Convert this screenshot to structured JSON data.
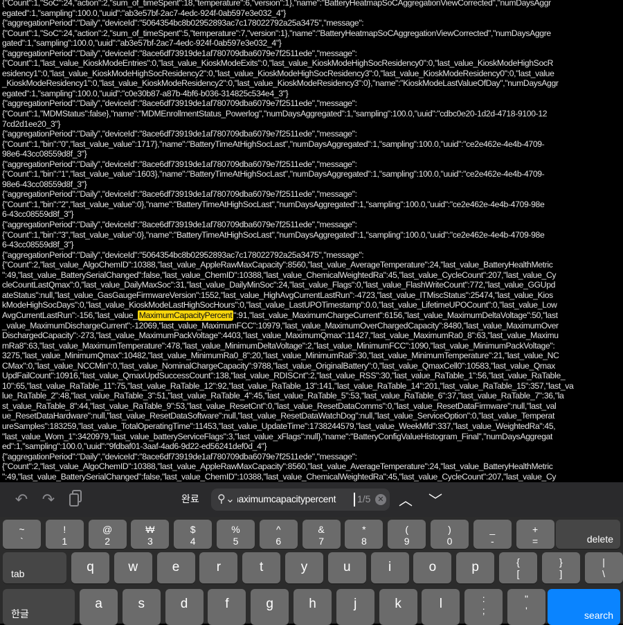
{
  "log": {
    "lines": [
      "{\"Count\":1,\"SoC\":24,\"action\":2,\"sum_of_timeSpent\":18,\"temperature\":6,\"version\":1},\"name\":\"BatteryHeatmapSoCAggregationViewCorrected\",\"numDaysAggr",
      "egated\":1,\"sampling\":100.0,\"uuid\":\"ab3e57bf-2ac7-4edc-924f-0ab597e3e032_4\"}",
      "{\"aggregationPeriod\":\"Daily\",\"deviceId\":\"5064354bc8b02952893ac7c178022792a25a3475\",\"message\":",
      "{\"Count\":1,\"SoC\":24,\"action\":2,\"sum_of_timeSpent\":5,\"temperature\":7,\"version\":1},\"name\":\"BatteryHeatmapSoCAggregationViewCorrected\",\"numDaysAggre",
      "gated\":1,\"sampling\":100.0,\"uuid\":\"ab3e57bf-2ac7-4edc-924f-0ab597e3e032_4\"}",
      "{\"aggregationPeriod\":\"Daily\",\"deviceId\":\"8ace6df73919de1af780709dba6079e7f2511ede\",\"message\":",
      "{\"Count\":1,\"last_value_KioskModeEntries\":0,\"last_value_KioskModeExits\":0,\"last_value_KioskModeHighSocResidency0\":0,\"last_value_KioskModeHighSocR",
      "esidency1\":0,\"last_value_KioskModeHighSocResidency2\":0,\"last_value_KioskModeHighSocResidency3\":0,\"last_value_KioskModeResidency0\":0,\"last_value",
      "_KioskModeResidency1\":0,\"last_value_KioskModeResidency2\":0,\"last_value_KioskModeResidency3\":0},\"name\":\"KioskModeLastValueOfDay\",\"numDaysAggr",
      "egated\":1,\"sampling\":100.0,\"uuid\":\"c0e30b87-a87b-4bf6-b036-314825c534e4_3\"}",
      "{\"aggregationPeriod\":\"Daily\",\"deviceId\":\"8ace6df73919de1af780709dba6079e7f2511ede\",\"message\":",
      "{\"Count\":1,\"MDMStatus\":false},\"name\":\"MDMEnrollmentStatus_Powerlog\",\"numDaysAggregated\":1,\"sampling\":100.0,\"uuid\":\"cdbc0e20-1d2d-4718-9100-12",
      "7cd2d1ee20_3\"}",
      "{\"aggregationPeriod\":\"Daily\",\"deviceId\":\"8ace6df73919de1af780709dba6079e7f2511ede\",\"message\":",
      "{\"Count\":1,\"bin\":\"0\",\"last_value_value\":1717},\"name\":\"BatteryTimeAtHighSocLast\",\"numDaysAggregated\":1,\"sampling\":100.0,\"uuid\":\"ce2e462e-4e4b-4709-",
      "98e6-43cc08559d8f_3\"}",
      "{\"aggregationPeriod\":\"Daily\",\"deviceId\":\"8ace6df73919de1af780709dba6079e7f2511ede\",\"message\":",
      "{\"Count\":1,\"bin\":\"1\",\"last_value_value\":1603},\"name\":\"BatteryTimeAtHighSocLast\",\"numDaysAggregated\":1,\"sampling\":100.0,\"uuid\":\"ce2e462e-4e4b-4709-",
      "98e6-43cc08559d8f_3\"}",
      "{\"aggregationPeriod\":\"Daily\",\"deviceId\":\"8ace6df73919de1af780709dba6079e7f2511ede\",\"message\":",
      "{\"Count\":1,\"bin\":\"2\",\"last_value_value\":0},\"name\":\"BatteryTimeAtHighSocLast\",\"numDaysAggregated\":1,\"sampling\":100.0,\"uuid\":\"ce2e462e-4e4b-4709-98e",
      "6-43cc08559d8f_3\"}",
      "{\"aggregationPeriod\":\"Daily\",\"deviceId\":\"8ace6df73919de1af780709dba6079e7f2511ede\",\"message\":",
      "{\"Count\":1,\"bin\":\"3\",\"last_value_value\":0},\"name\":\"BatteryTimeAtHighSocLast\",\"numDaysAggregated\":1,\"sampling\":100.0,\"uuid\":\"ce2e462e-4e4b-4709-98e",
      "6-43cc08559d8f_3\"}",
      "{\"aggregationPeriod\":\"Daily\",\"deviceId\":\"5064354bc8b02952893ac7c178022792a25a3475\",\"message\":",
      "{\"Count\":2,\"last_value_AlgoChemID\":10388,\"last_value_AppleRawMaxCapacity\":8560,\"last_value_AverageTemperature\":24,\"last_value_BatteryHealthMetric",
      "\":49,\"last_value_BatterySerialChanged\":false,\"last_value_ChemID\":10388,\"last_value_ChemicalWeightedRa\":45,\"last_value_CycleCount\":207,\"last_value_Cy",
      "cleCountLastQmax\":0,\"last_value_DailyMaxSoc\":31,\"last_value_DailyMinSoc\":24,\"last_value_Flags\":0,\"last_value_FlashWriteCount\":772,\"last_value_GGUpd",
      "ateStatus\":null,\"last_value_GasGaugeFirmwareVersion\":1552,\"last_value_HighAvgCurrentLastRun\":-4723,\"last_value_ITMiscStatus\":25474,\"last_value_Kios",
      "kModeHighSocDays\":0,\"last_value_KioskModeLastHighSocHours\":0,\"last_value_LastUPOTimestamp\":0.0,\"last_value_LifetimeUPOCount\":0,\"last_value_Low",
      [
        "AvgCurrentLastRun\":-156,\"last_value_",
        "MaximumCapacityPercent",
        "\":91,\"last_value_MaximumChargeCurrent\":6156,\"last_value_MaximumDeltaVoltage\":50,\"last"
      ],
      "_value_MaximumDischargeCurrent\":-12069,\"last_value_MaximumFCC\":10979,\"last_value_MaximumOverChargedCapacity\":8480,\"last_value_MaximumOver",
      "DischargedCapacity\":-273,\"last_value_MaximumPackVoltage\":4403,\"last_value_MaximumQmax\":11427,\"last_value_MaximumRa0_8\":63,\"last_value_Maximu",
      "mRa8\":63,\"last_value_MaximumTemperature\":478,\"last_value_MinimumDeltaVoltage\":2,\"last_value_MinimumFCC\":1090,\"last_value_MinimumPackVoltage\":",
      "3275,\"last_value_MinimumQmax\":10482,\"last_value_MinimumRa0_8\":20,\"last_value_MinimumRa8\":30,\"last_value_MinimumTemperature\":21,\"last_value_NC",
      "CMax\":0,\"last_value_NCCMin\":0,\"last_value_NominalChargeCapacity\":9788,\"last_value_OriginalBattery\":0,\"last_value_QmaxCell0\":10583,\"last_value_Qmax",
      "UpdFailCount\":10916,\"last_value_QmaxUpdSuccessCount\":138,\"last_value_RDISCnt\":2,\"last_value_RSS\":30,\"last_value_RaTable_1\":56,\"last_value_RaTable_",
      "10\":65,\"last_value_RaTable_11\":75,\"last_value_RaTable_12\":92,\"last_value_RaTable_13\":141,\"last_value_RaTable_14\":201,\"last_value_RaTable_15\":357,\"last_va",
      "lue_RaTable_2\":48,\"last_value_RaTable_3\":51,\"last_value_RaTable_4\":45,\"last_value_RaTable_5\":53,\"last_value_RaTable_6\":37,\"last_value_RaTable_7\":36,\"la",
      "st_value_RaTable_8\":44,\"last_value_RaTable_9\":53,\"last_value_ResetCnt\":0,\"last_value_ResetDataComms\":0,\"last_value_ResetDataFirmware\":null,\"last_val",
      "ue_ResetDataHardware\":null,\"last_value_ResetDataSoftware\":null,\"last_value_ResetDataWatchDog\":null,\"last_value_ServiceOption\":0,\"last_value_Temperat",
      "ureSamples\":183259,\"last_value_TotalOperatingTime\":11453,\"last_value_UpdateTime\":1738244579,\"last_value_WeekMfd\":337,\"last_value_WeightedRa\":45,",
      "\"last_value_Wom_1\":3420979,\"last_value_batteryServiceFlags\":3,\"last_value_xFlags\":null},\"name\":\"BatteryConfigValueHistogram_Final\",\"numDaysAggregat",
      "ed\":1,\"sampling\":100.0,\"uuid\":\"9fdbaf01-3aaf-4ad6-9d22-ed56241def0d_4\"}",
      "{\"aggregationPeriod\":\"Daily\",\"deviceId\":\"8ace6df73919de1af780709dba6079e7f2511ede\",\"message\":",
      "{\"Count\":2,\"last_value_AlgoChemID\":10388,\"last_value_AppleRawMaxCapacity\":8560,\"last_value_AverageTemperature\":24,\"last_value_BatteryHealthMetric",
      "\":49,\"last_value_BatterySerialChanged\":false,\"last_value_ChemID\":10388,\"last_value_ChemicalWeightedRa\":45,\"last_value_CycleCount\":207,\"last_value_Cy"
    ],
    "highlight_color": "#f7d50c"
  },
  "toolbar": {
    "undo_icon": "undo-icon",
    "redo_icon": "redo-icon",
    "paste_icon": "clipboard-icon",
    "done_label": "완료",
    "search_icon": "magnifier-dropdown-icon",
    "search_value": "naximumcapacitypercent",
    "match_count": "1/5",
    "clear_icon": "clear-icon",
    "prev_icon": "chevron-up-icon",
    "next_icon": "chevron-down-icon"
  },
  "keyboard": {
    "accent_color": "#0a84ff",
    "row1": [
      [
        "~",
        "`"
      ],
      [
        "!",
        "1"
      ],
      [
        "@",
        "2"
      ],
      [
        "₩",
        "3"
      ],
      [
        "$",
        "4"
      ],
      [
        "%",
        "5"
      ],
      [
        "^",
        "6"
      ],
      [
        "&",
        "7"
      ],
      [
        "*",
        "8"
      ],
      [
        "(",
        "9"
      ],
      [
        ")",
        "0"
      ],
      [
        "_",
        "-"
      ],
      [
        "+",
        "="
      ]
    ],
    "delete_label": "delete",
    "tab_label": "tab",
    "row2": [
      "q",
      "w",
      "e",
      "r",
      "t",
      "y",
      "u",
      "i",
      "o",
      "p"
    ],
    "row2_sym": [
      [
        "{",
        "["
      ],
      [
        "}",
        "]"
      ],
      [
        "|",
        "\\"
      ]
    ],
    "lang_label": "한글",
    "row3": [
      "a",
      "s",
      "d",
      "f",
      "g",
      "h",
      "j",
      "k",
      "l"
    ],
    "row3_sym": [
      [
        ":",
        ";"
      ],
      [
        "\"",
        "'"
      ]
    ],
    "search_label": "search"
  }
}
